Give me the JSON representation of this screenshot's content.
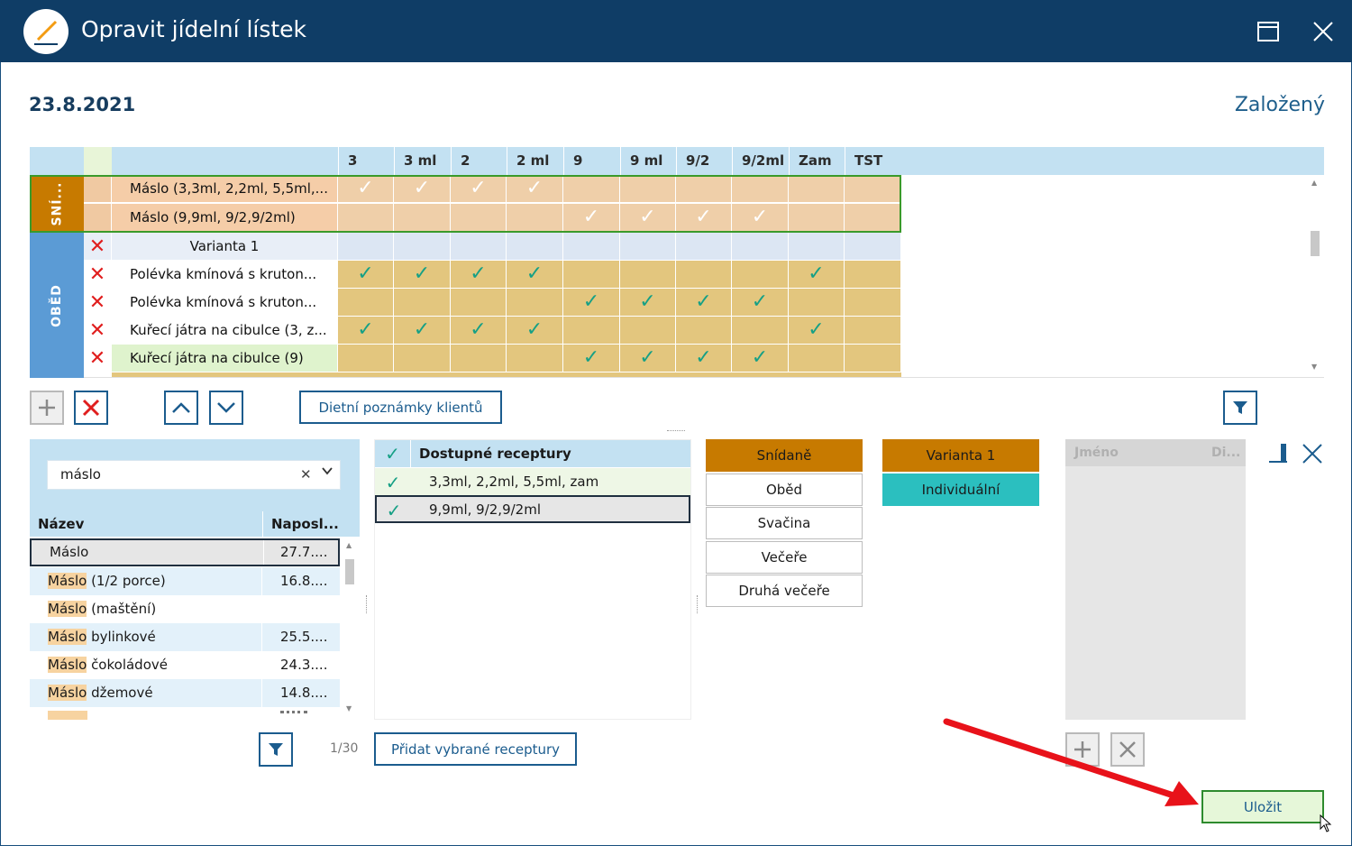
{
  "window": {
    "title": "Opravit jídelní lístek"
  },
  "header": {
    "date": "23.8.2021",
    "status": "Založený"
  },
  "grid": {
    "columns": [
      "3",
      "3 ml",
      "2",
      "2 ml",
      "9",
      "9 ml",
      "9/2",
      "9/2ml",
      "Zam",
      "TST"
    ],
    "groups": [
      {
        "label": "SNÍ...",
        "color": "#c77a00"
      },
      {
        "label": "OBĚD",
        "color": "#5b9bd5"
      }
    ],
    "rows": [
      {
        "name": "Máslo (3,3ml,  2,2ml, 5,5ml,...",
        "checks": [
          true,
          true,
          true,
          true,
          false,
          false,
          false,
          false,
          false,
          false
        ]
      },
      {
        "name": "Máslo (9,9ml,  9/2,9/2ml)",
        "checks": [
          false,
          false,
          false,
          false,
          true,
          true,
          true,
          true,
          false,
          false
        ]
      },
      {
        "name": "Varianta 1",
        "checks": [
          false,
          false,
          false,
          false,
          false,
          false,
          false,
          false,
          false,
          false
        ]
      },
      {
        "name": "Polévka kmínová s kruton...",
        "checks": [
          true,
          true,
          true,
          true,
          false,
          false,
          false,
          false,
          true,
          false
        ]
      },
      {
        "name": "Polévka kmínová s kruton...",
        "checks": [
          false,
          false,
          false,
          false,
          true,
          true,
          true,
          true,
          false,
          false
        ]
      },
      {
        "name": "Kuřecí játra na cibulce (3, z...",
        "checks": [
          true,
          true,
          true,
          true,
          false,
          false,
          false,
          false,
          true,
          false
        ]
      },
      {
        "name": "Kuřecí játra na cibulce (9)",
        "checks": [
          false,
          false,
          false,
          false,
          true,
          true,
          true,
          true,
          false,
          false
        ]
      }
    ]
  },
  "toolbar": {
    "dietary_notes_label": "Dietní poznámky klientů"
  },
  "search": {
    "value": "máslo"
  },
  "food_list": {
    "headers": {
      "name": "Název",
      "last": "Naposl..."
    },
    "rows": [
      {
        "highlight": "Máslo",
        "rest": "",
        "last": "27.7...."
      },
      {
        "highlight": "Máslo",
        "rest": " (1/2 porce)",
        "last": "16.8...."
      },
      {
        "highlight": "Máslo",
        "rest": " (maštění)",
        "last": ""
      },
      {
        "highlight": "Máslo",
        "rest": " bylinkové",
        "last": "25.5...."
      },
      {
        "highlight": "Máslo",
        "rest": " čokoládové",
        "last": "24.3...."
      },
      {
        "highlight": "Máslo",
        "rest": " džemové",
        "last": "14.8...."
      }
    ],
    "pager": "1/30"
  },
  "recipes": {
    "header": "Dostupné receptury",
    "rows": [
      "3,3ml,  2,2ml, 5,5ml, zam",
      "9,9ml,  9/2,9/2ml"
    ],
    "add_label": "Přidat vybrané receptury"
  },
  "meals": [
    "Snídaně",
    "Oběd",
    "Svačina",
    "Večeře",
    "Druhá večeře"
  ],
  "variants": [
    "Varianta 1",
    "Individuální"
  ],
  "clients": {
    "name_header": "Jméno",
    "di_header": "Di..."
  },
  "save_label": "Uložit",
  "colors": {
    "titlebar": "#0f3d66",
    "accent": "#1b5c8e",
    "orange": "#c77a00",
    "teal": "#2bbfbf",
    "save_bg": "#e6f7d9"
  }
}
